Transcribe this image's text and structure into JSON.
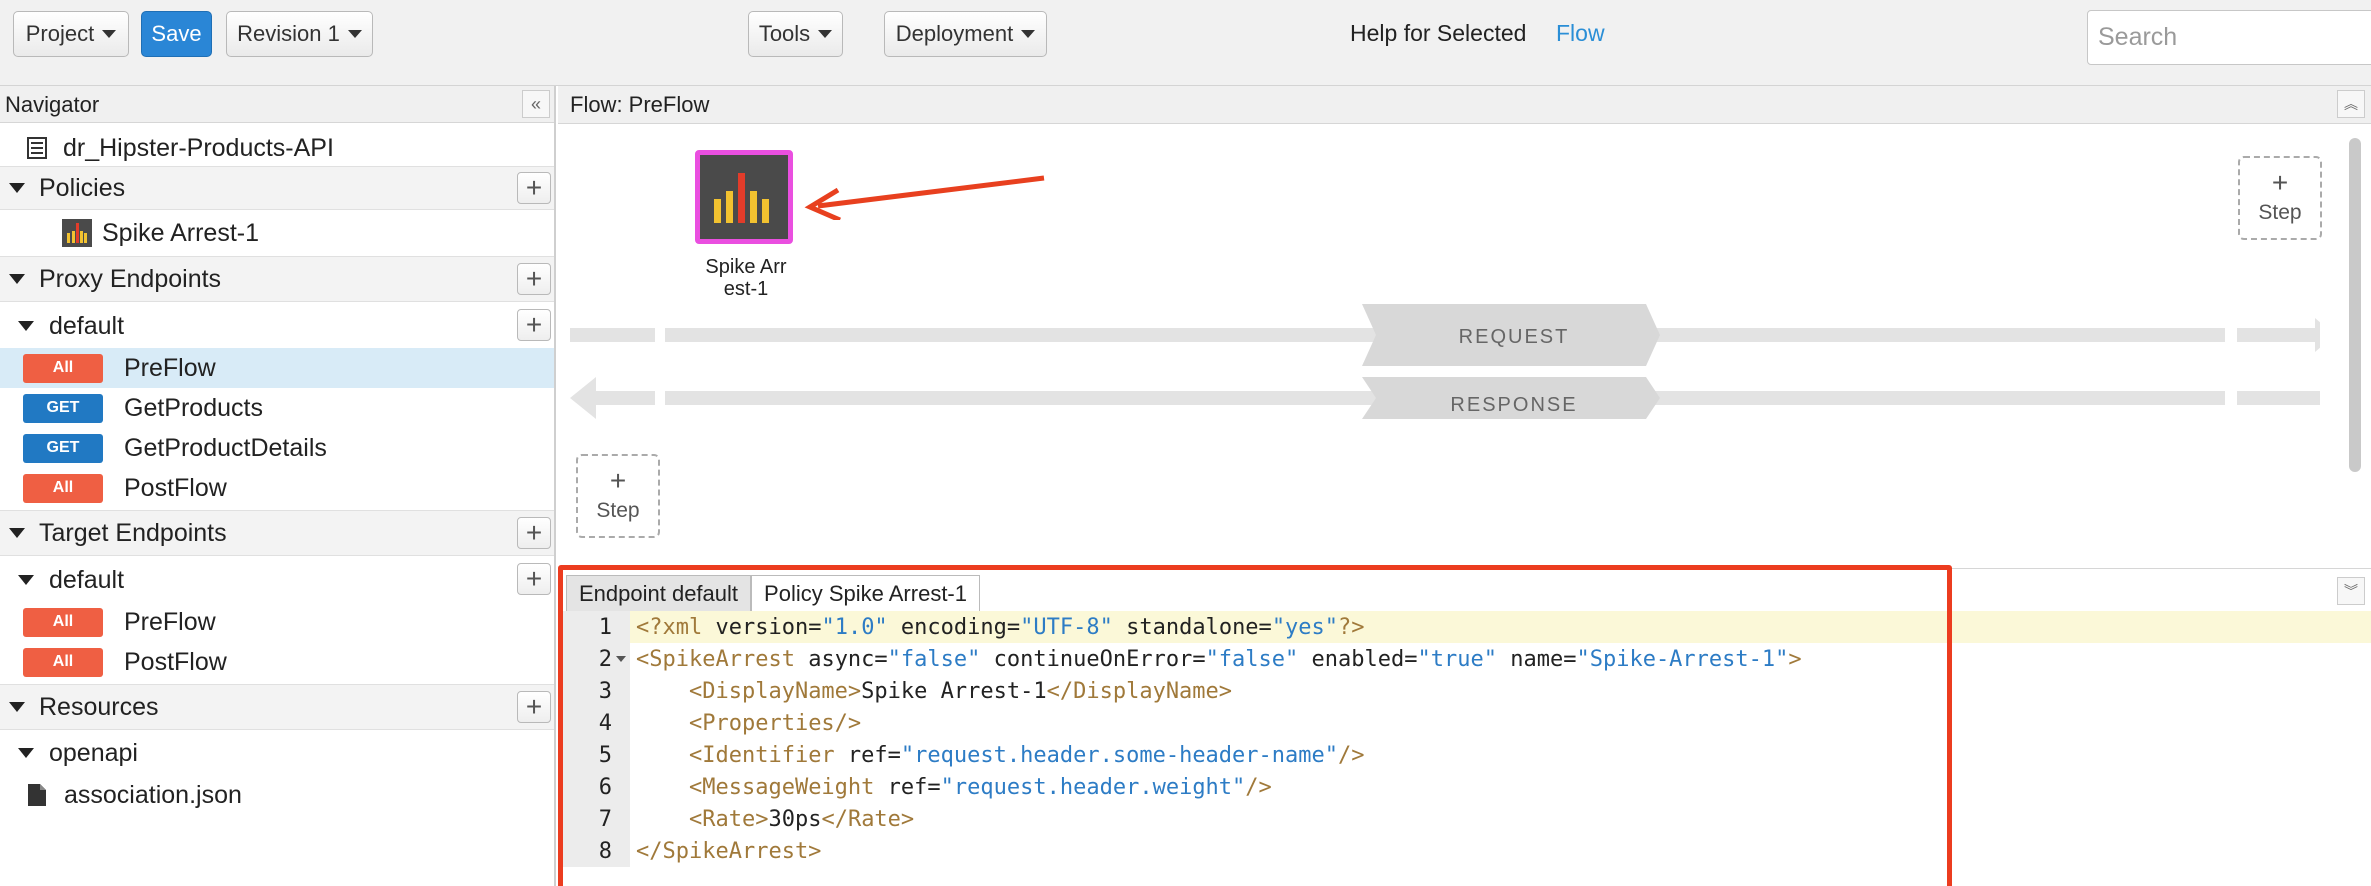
{
  "toolbar": {
    "project_label": "Project",
    "save_label": "Save",
    "revision_label": "Revision 1",
    "tools_label": "Tools",
    "deployment_label": "Deployment",
    "help_label": "Help for Selected",
    "help_link": "Flow",
    "search_placeholder": "Search"
  },
  "navigator": {
    "title": "Navigator",
    "proxy_name": "dr_Hipster-Products-API",
    "policies": {
      "label": "Policies",
      "items": [
        "Spike Arrest-1"
      ]
    },
    "proxy_endpoints": {
      "label": "Proxy Endpoints",
      "group": "default",
      "flows": [
        {
          "badge": "All",
          "name": "PreFlow"
        },
        {
          "badge": "GET",
          "name": "GetProducts"
        },
        {
          "badge": "GET",
          "name": "GetProductDetails"
        },
        {
          "badge": "All",
          "name": "PostFlow"
        }
      ]
    },
    "target_endpoints": {
      "label": "Target Endpoints",
      "group": "default",
      "flows": [
        {
          "badge": "All",
          "name": "PreFlow"
        },
        {
          "badge": "All",
          "name": "PostFlow"
        }
      ]
    },
    "resources": {
      "label": "Resources",
      "group": "openapi",
      "file": "association.json"
    }
  },
  "flow": {
    "title": "Flow: PreFlow",
    "policy_label_line1": "Spike Arr",
    "policy_label_line2": "est-1",
    "request_label": "REQUEST",
    "response_label": "RESPONSE",
    "step_label": "Step",
    "plus": "+"
  },
  "editor": {
    "tabs": [
      "Endpoint default",
      "Policy Spike Arrest-1"
    ],
    "line_numbers": [
      "1",
      "2",
      "3",
      "4",
      "5",
      "6",
      "7",
      "8"
    ],
    "code": [
      [
        [
          "t",
          "<?xml "
        ],
        [
          "a",
          "version="
        ],
        [
          "v",
          "\"1.0\""
        ],
        [
          "a",
          " encoding="
        ],
        [
          "v",
          "\"UTF-8\""
        ],
        [
          "a",
          " standalone="
        ],
        [
          "v",
          "\"yes\""
        ],
        [
          "t",
          "?>"
        ]
      ],
      [
        [
          "t",
          "<SpikeArrest"
        ],
        [
          "a",
          " async="
        ],
        [
          "v",
          "\"false\""
        ],
        [
          "a",
          " continueOnError="
        ],
        [
          "v",
          "\"false\""
        ],
        [
          "a",
          " enabled="
        ],
        [
          "v",
          "\"true\""
        ],
        [
          "a",
          " name="
        ],
        [
          "v",
          "\"Spike-Arrest-1\""
        ],
        [
          "t",
          ">"
        ]
      ],
      [
        [
          "a",
          "    "
        ],
        [
          "t",
          "<DisplayName>"
        ],
        [
          "a",
          "Spike Arrest-1"
        ],
        [
          "t",
          "</DisplayName>"
        ]
      ],
      [
        [
          "a",
          "    "
        ],
        [
          "t",
          "<Properties/>"
        ]
      ],
      [
        [
          "a",
          "    "
        ],
        [
          "t",
          "<Identifier"
        ],
        [
          "a",
          " ref="
        ],
        [
          "v",
          "\"request.header.some-header-name\""
        ],
        [
          "t",
          "/>"
        ]
      ],
      [
        [
          "a",
          "    "
        ],
        [
          "t",
          "<MessageWeight"
        ],
        [
          "a",
          " ref="
        ],
        [
          "v",
          "\"request.header.weight\""
        ],
        [
          "t",
          "/>"
        ]
      ],
      [
        [
          "a",
          "    "
        ],
        [
          "t",
          "<Rate>"
        ],
        [
          "a",
          "30ps"
        ],
        [
          "t",
          "</Rate>"
        ]
      ],
      [
        [
          "t",
          "</SpikeArrest>"
        ]
      ]
    ]
  },
  "colors": {
    "save_button": "#2a86d6",
    "badge_all": "#ef5f43",
    "badge_get": "#2179c3",
    "highlight_border": "#ec3c1f",
    "policy_border": "#ea4fe0"
  }
}
